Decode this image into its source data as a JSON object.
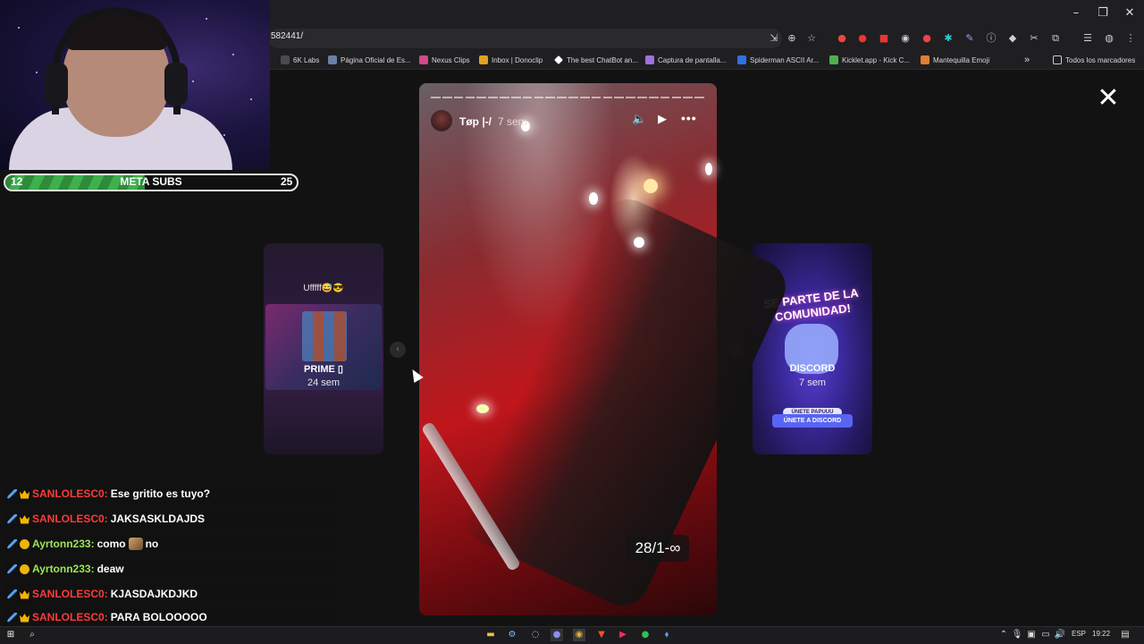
{
  "browser": {
    "url": "582441/",
    "window_controls": [
      "minimize",
      "restore",
      "close"
    ],
    "toolbar_icons": [
      "install-icon",
      "zoom-icon",
      "star-icon",
      "extension-icon",
      "extension-icon",
      "adblock-icon",
      "extension-icon",
      "extension-icon",
      "extension-icon",
      "extension-icon",
      "info-icon",
      "extension-icon",
      "extension-icon",
      "puzzle-icon",
      "playlist-icon",
      "profile-icon",
      "menu-icon"
    ],
    "bookmarks": [
      {
        "label": "6K Labs",
        "color": "#4a4a4a"
      },
      {
        "label": "Página Oficial de Es...",
        "color": "#6b7fa8"
      },
      {
        "label": "Nexus Clips",
        "color": "#d04a8a"
      },
      {
        "label": "Inbox | Donoclip",
        "color": "#e0a020"
      },
      {
        "label": "The best ChatBot an...",
        "color": "#ffffff"
      },
      {
        "label": "Captura de pantalla...",
        "color": "#a070e0"
      },
      {
        "label": "Spiderman ASCII Ar...",
        "color": "#3070e0"
      },
      {
        "label": "Kicklet.app - Kick C...",
        "color": "#50b050"
      },
      {
        "label": "Mantequilla Emoji",
        "color": "#e08030"
      }
    ],
    "bookmarks_more": "»",
    "bookmarks_folder": "Todos los marcadores"
  },
  "stream": {
    "sub_goal": {
      "current": "12",
      "label": "META SUBS",
      "target": "25",
      "fraction": 0.48
    }
  },
  "story_viewer": {
    "close_label": "✕",
    "prev_arrow": "‹",
    "next_arrow": "›",
    "prev_card": {
      "caption": "Ufffff😅😎",
      "title": "PRIME ▯",
      "time": "24 sem"
    },
    "next_card": {
      "banner": "SE PARTE DE LA COMUNIDAD!",
      "title": "DISCORD",
      "time": "7 sem",
      "sub_label": "ÚNETE PAPUUU",
      "button_label": "ÚNETE A DISCORD"
    },
    "current": {
      "user": "Tøp |-/",
      "time": "7 sem",
      "sticker": "28/1-∞",
      "segments": 24
    }
  },
  "chat": [
    {
      "badges": [
        "sword",
        "crown"
      ],
      "user": "SANLOLESC0:",
      "user_color": "red",
      "message": "Ese gritito es tuyo?"
    },
    {
      "badges": [
        "sword",
        "crown"
      ],
      "user": "SANLOLESC0:",
      "user_color": "red",
      "message": "JAKSASKLDAJDS"
    },
    {
      "badges": [
        "sword",
        "circle"
      ],
      "user": "Ayrtonn233:",
      "user_color": "green",
      "message": "como",
      "emote": true,
      "message2": "no"
    },
    {
      "badges": [
        "sword",
        "circle"
      ],
      "user": "Ayrtonn233:",
      "user_color": "green",
      "message": "deaw"
    },
    {
      "badges": [
        "sword",
        "crown"
      ],
      "user": "SANLOLESC0:",
      "user_color": "red",
      "message": "KJASDAJKDJKD"
    },
    {
      "badges": [
        "sword",
        "crown"
      ],
      "user": "SANLOLESC0:",
      "user_color": "red",
      "message": "PARA BOLOOOOO"
    }
  ],
  "taskbar": {
    "language": "ESP",
    "clock": "19:22"
  }
}
